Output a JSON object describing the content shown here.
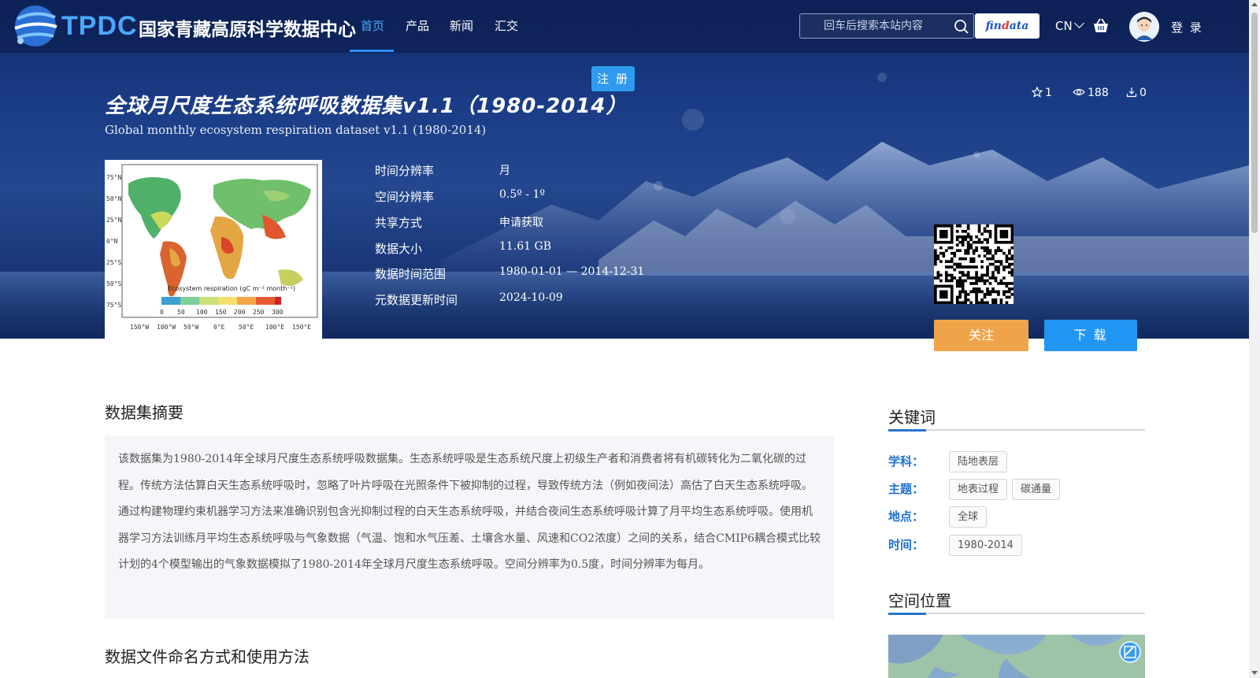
{
  "nav": {
    "logo_text": "TPDC",
    "site_name": "国家青藏高原科学数据中心",
    "items": [
      {
        "label": "首页",
        "active": true
      },
      {
        "label": "产品",
        "active": false
      },
      {
        "label": "新闻",
        "active": false
      },
      {
        "label": "汇交",
        "active": false
      }
    ],
    "search_placeholder": "回车后搜索本站内容",
    "findata_label_1": "fin",
    "findata_label_2": "d",
    "findata_label_3": "ata",
    "lang": "CN",
    "login": "登 录",
    "register": "注 册"
  },
  "dataset": {
    "title_cn": "全球月尺度生态系统呼吸数据集v1.1（1980-2014）",
    "title_en": "Global monthly ecosystem respiration dataset v1.1 (1980-2014)",
    "stars": "1",
    "views": "188",
    "downloads": "0",
    "meta": [
      {
        "label": "时间分辨率",
        "value": "月"
      },
      {
        "label": "空间分辨率",
        "value": "0.5º - 1º"
      },
      {
        "label": "共享方式",
        "value": "申请获取"
      },
      {
        "label": "数据大小",
        "value": "11.61 GB"
      },
      {
        "label": "数据时间范围",
        "value": "1980-01-01 — 2014-12-31"
      },
      {
        "label": "元数据更新时间",
        "value": "2024-10-09"
      }
    ],
    "follow": "关注",
    "download": "下 载"
  },
  "thumbnail": {
    "lat_labels": [
      "75°N",
      "50°N",
      "25°N",
      "0°N",
      "25°S",
      "50°S",
      "75°S"
    ],
    "lon_labels": [
      "150°W",
      "100°W",
      "50°W",
      "0°E",
      "50°E",
      "100°E",
      "150°E"
    ],
    "legend_title": "Ecosystem respiration (gC m⁻² month⁻¹)",
    "legend_ticks": [
      "0",
      "50",
      "100",
      "150",
      "200",
      "250",
      "300"
    ]
  },
  "abstract": {
    "title": "数据集摘要",
    "text": "该数据集为1980-2014年全球月尺度生态系统呼吸数据集。生态系统呼吸是生态系统尺度上初级生产者和消费者将有机碳转化为二氧化碳的过程。传统方法估算白天生态系统呼吸时，忽略了叶片呼吸在光照条件下被抑制的过程，导致传统方法（例如夜间法）高估了白天生态系统呼吸。通过构建物理约束机器学习方法来准确识别包含光抑制过程的白天生态系统呼吸，并结合夜间生态系统呼吸计算了月平均生态系统呼吸。使用机器学习方法训练月平均生态系统呼吸与气象数据（气温、饱和水气压差、土壤含水量、风速和CO2浓度）之间的关系，结合CMIP6耦合模式比较计划的4个模型输出的气象数据模拟了1980-2014年全球月尺度生态系统呼吸。空间分辨率为0.5度，时间分辨率为每月。"
  },
  "file_naming": {
    "title": "数据文件命名方式和使用方法"
  },
  "keywords": {
    "title": "关键词",
    "rows": [
      {
        "label": "学科：",
        "tags": [
          "陆地表层"
        ]
      },
      {
        "label": "主题：",
        "tags": [
          "地表过程",
          "碳通量"
        ]
      },
      {
        "label": "地点：",
        "tags": [
          "全球"
        ]
      },
      {
        "label": "时间：",
        "tags": [
          "1980-2014"
        ]
      }
    ]
  },
  "spatial": {
    "title": "空间位置"
  },
  "colors": {
    "accent": "#2e8dff",
    "follow": "#f0a44a",
    "download": "#2196f3",
    "keyword_label": "#1e6fd0"
  }
}
